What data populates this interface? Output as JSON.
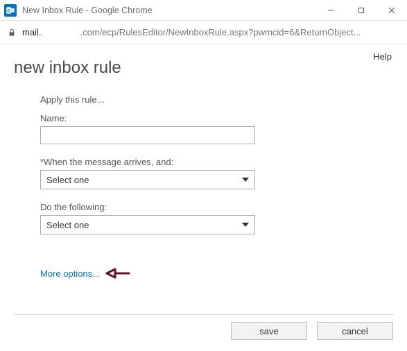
{
  "window": {
    "title": "New Inbox Rule - Google Chrome"
  },
  "address": {
    "host": "mail.",
    "path": ".com/ecp/RulesEditor/NewInboxRule.aspx?pwmcid=6&ReturnObject..."
  },
  "header": {
    "help": "Help",
    "page_title": "new inbox rule"
  },
  "form": {
    "intro": "Apply this rule...",
    "name_label": "Name:",
    "name_value": "",
    "condition_label": "*When the message arrives, and:",
    "condition_selected": "Select one",
    "action_label": "Do the following:",
    "action_selected": "Select one",
    "more_options": "More options..."
  },
  "footer": {
    "save": "save",
    "cancel": "cancel"
  }
}
